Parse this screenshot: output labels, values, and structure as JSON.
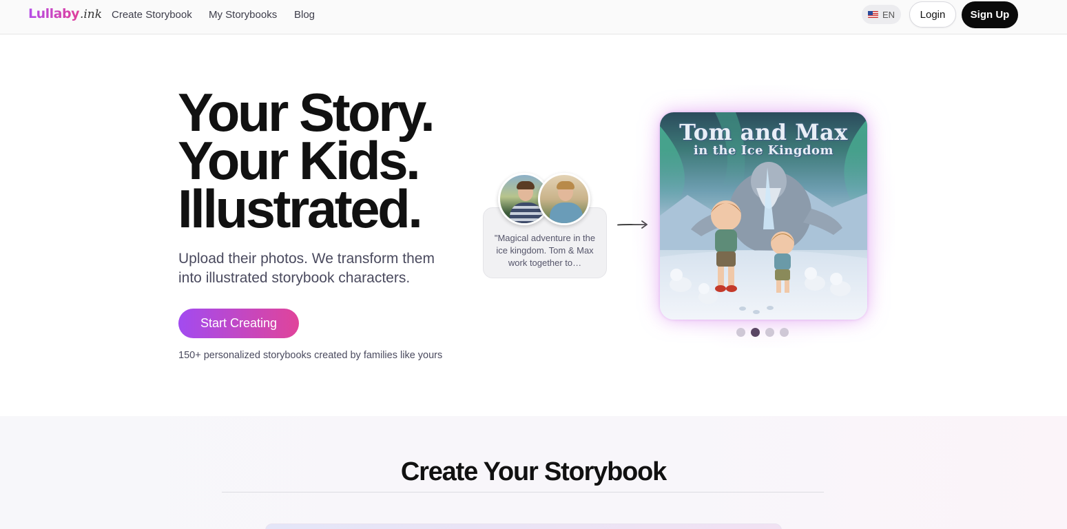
{
  "nav": {
    "logo_main": "Lullaby",
    "logo_sub": ".ink",
    "links": [
      "Create Storybook",
      "My Storybooks",
      "Blog"
    ],
    "language": "EN",
    "login_label": "Login",
    "signup_label": "Sign Up"
  },
  "hero": {
    "headline": [
      "Your Story.",
      "Your Kids.",
      "Illustrated."
    ],
    "subhead": "Upload their photos. We transform them into illustrated storybook characters.",
    "cta_label": "Start Creating",
    "social_proof": "150+ personalized storybooks created by families like yours",
    "prompt_text": "\"Magical adventure in the ice kingdom. Tom & Max work together to…",
    "cover_title_line1": "Tom and Max",
    "cover_title_line2": "in the Ice Kingdom",
    "carousel": {
      "count": 4,
      "active_index": 1
    }
  },
  "section2": {
    "title": "Create Your Storybook"
  },
  "colors": {
    "accent_start": "#a24bf0",
    "accent_end": "#e0449a",
    "signup_bg": "#0b0b0b",
    "dot_active": "#5a4664"
  }
}
